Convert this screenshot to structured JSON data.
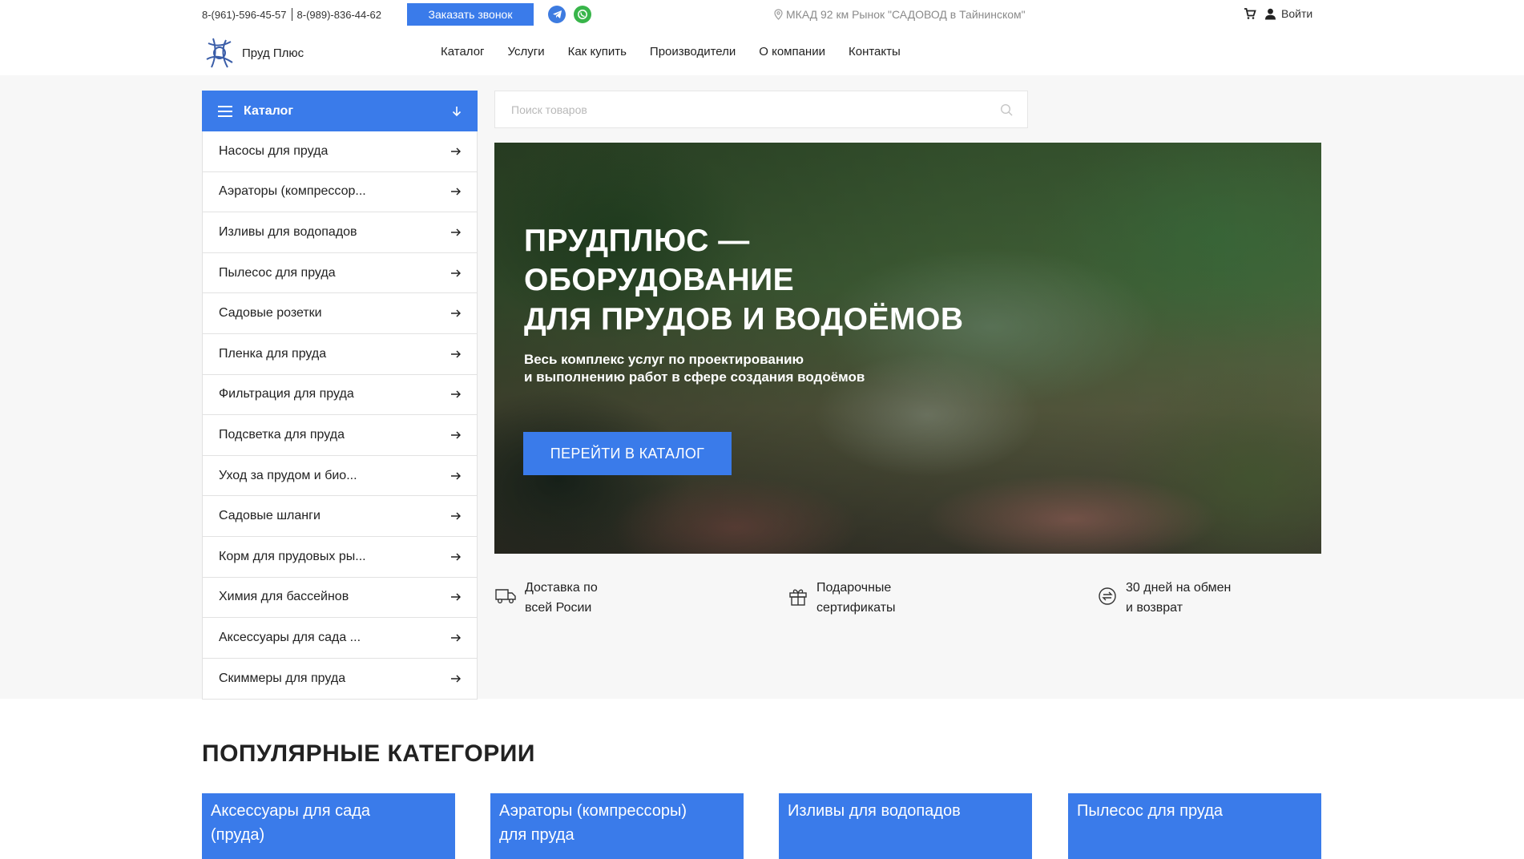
{
  "topbar": {
    "phone1": "8-(961)-596-45-57",
    "phone2": "8-(989)-836-44-62",
    "call_button": "Заказать звонок",
    "telegram_icon": "telegram-icon",
    "whatsapp_icon": "whatsapp-icon",
    "address": "МКАД 92 км Рынок \"САДОВОД в Тайнинском\"",
    "login": "Войти"
  },
  "header": {
    "logo_text": "Пруд Плюс",
    "nav": [
      "Каталог",
      "Услуги",
      "Как купить",
      "Производители",
      "О компании",
      "Контакты"
    ]
  },
  "catalog": {
    "title": "Каталог",
    "items": [
      "Насосы для пруда",
      "Аэраторы (компрессор...",
      "Изливы для водопадов",
      "Пылесос для пруда",
      "Садовые розетки",
      "Пленка для пруда",
      "Фильтрация для пруда",
      "Подсветка для пруда",
      "Уход за прудом и био...",
      "Садовые шланги",
      "Корм для прудовых ры...",
      "Химия для бассейнов",
      "Аксессуары для сада ...",
      "Скиммеры для пруда"
    ]
  },
  "search": {
    "placeholder": "Поиск товаров",
    "value": ""
  },
  "hero": {
    "title_line1": "ПРУДПЛЮС —",
    "title_line2": "ОБОРУДОВАНИЕ",
    "title_line3": "ДЛЯ ПРУДОВ И ВОДОЁМОВ",
    "subtitle_line1": "Весь комплекс услуг по проектированию",
    "subtitle_line2": "и выполнению работ в сфере создания водоёмов",
    "button": "ПЕРЕЙТИ В КАТАЛОГ"
  },
  "features": [
    {
      "icon": "truck-icon",
      "line1": "Доставка по",
      "line2": "всей Росии"
    },
    {
      "icon": "gift-icon",
      "line1": "Подарочные",
      "line2": "сертификаты"
    },
    {
      "icon": "exchange-icon",
      "line1": "30 дней на обмен",
      "line2": "и возврат"
    }
  ],
  "popular": {
    "title": "ПОПУЛЯРНЫЕ КАТЕГОРИИ",
    "cards": [
      {
        "line1": "Аксессуары для сада",
        "line2": "(пруда)"
      },
      {
        "line1": "Аэраторы (компрессоры)",
        "line2": "для пруда"
      },
      {
        "line1": "Изливы для водопадов",
        "line2": ""
      },
      {
        "line1": "Пылесос для пруда",
        "line2": ""
      }
    ]
  },
  "colors": {
    "accent": "#3a7bea",
    "whatsapp": "#38b54a",
    "telegram": "#3d7be0",
    "page_bg": "#f7f7f7"
  }
}
